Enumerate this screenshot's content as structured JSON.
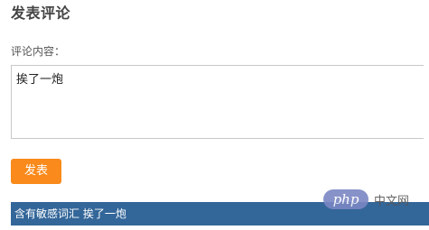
{
  "comment_form": {
    "title": "发表评论",
    "content_label": "评论内容：",
    "content_value": "挨了一炮",
    "submit_label": "发表"
  },
  "result": {
    "message": "含有敏感词汇 挨了一炮"
  },
  "watermark": {
    "logo_text": "php",
    "site_text": "中文网"
  },
  "colors": {
    "submit_button": "#f98a1b",
    "result_bar": "#336699"
  }
}
